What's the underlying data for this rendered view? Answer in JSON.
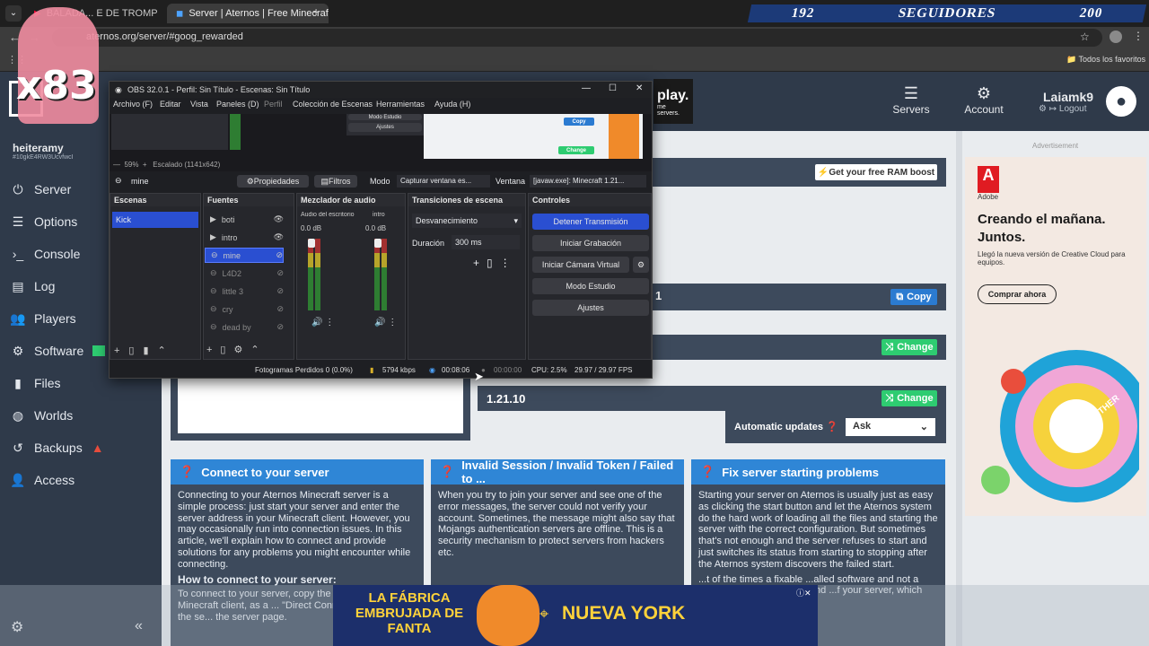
{
  "browser": {
    "tabs": [
      {
        "title": "BALADA... E DE TROMPETA..."
      },
      {
        "title": "Server | Aternos | Free Minecraft..."
      }
    ],
    "url": "aternos.org/server/#goog_rewarded",
    "bookmarks_label": "Todos los favoritos"
  },
  "overlay": {
    "counter_left": "192",
    "counter_label": "SEGUIDORES",
    "counter_right": "200",
    "multiplier": "x83"
  },
  "site": {
    "user": {
      "name": "heiteramy",
      "id": "#10gkE4RW3UcvfwcI"
    },
    "nav": [
      "Server",
      "Options",
      "Console",
      "Log",
      "Players",
      "Software",
      "Files",
      "Worlds",
      "Backups",
      "Access"
    ],
    "header": {
      "servers": "Servers",
      "account": "Account",
      "username": "Laiamk9",
      "logout": "Logout",
      "banner_text": "play.",
      "banner_sub": "me servers."
    },
    "ram_boost": "Get your free RAM boost",
    "copy": "Copy",
    "change": "Change",
    "version": "1.21.10",
    "auto_updates_label": "Automatic updates",
    "auto_updates_value": "Ask",
    "cards": [
      {
        "title": "Connect to your server",
        "body": "Connecting to your Aternos Minecraft server is a simple process: just start your server and enter the server address in your Minecraft client. However, you may occasionally run into connection issues. In this article, we'll explain how to connect and provide solutions for any problems you might encounter while connecting.",
        "subtitle": "How to connect to your server:",
        "extra": "To connect to your server, copy the s... enter it in your Minecraft client, as a ... \"Direct Connect\". You can find the se... the server page."
      },
      {
        "title": "Invalid Session / Invalid Token / Failed to ...",
        "body": "When you try to join your server and see one of the error messages, the server could not verify your account. Sometimes, the message might also say that Mojangs authentication servers are offline. This is a security mechanism to protect servers from hackers etc."
      },
      {
        "title": "Fix server starting problems",
        "body": "Starting your server on Aternos is usually just as easy as clicking the start button and let the Aternos system do the hard work of loading all the files and starting the server with the correct configuration. But sometimes that's not enough and the server refuses to start and just switches its status from starting to stopping after the Aternos system discovers the failed start.",
        "extra": "...t of the times a fixable ...alled software and not a ...em. The best source to find ...f your server, which you can"
      }
    ],
    "advertisement": "Advertisement"
  },
  "ad": {
    "brand": "Adobe",
    "headline": "Creando el mañana. Juntos.",
    "sub": "Llegó la nueva versión de Creative Cloud para equipos.",
    "cta": "Comprar ahora",
    "art_text": "TOGETHER"
  },
  "banner": {
    "left": "LA FÁBRICA EMBRUJADA DE FANTA",
    "right": "NUEVA YORK"
  },
  "obs": {
    "title": "OBS 32.0.1 - Perfil: Sin Título - Escenas: Sin Título",
    "menu": [
      "Archivo (F)",
      "Editar",
      "Vista",
      "Paneles (D)",
      "Perfil",
      "Colección de Escenas",
      "Herramientas",
      "Ayuda (H)"
    ],
    "zoom": "59%",
    "scale": "Escalado (1141x642)",
    "source_name": "mine",
    "properties": "Propiedades",
    "filters": "Filtros",
    "mode_label": "Modo",
    "mode_value": "Capturar ventana es...",
    "window_label": "Ventana",
    "window_value": "[javaw.exe]: Minecraft 1.21...",
    "docks": {
      "scenes": "Escenas",
      "sources": "Fuentes",
      "mixer": "Mezclador de audio",
      "transitions": "Transiciones de escena",
      "controls": "Controles"
    },
    "scenes": [
      "Kick"
    ],
    "sources": [
      "boti",
      "intro",
      "mine",
      "L4D2",
      "little 3",
      "cry",
      "dead by"
    ],
    "mixer": [
      {
        "name": "Audio del escritorio",
        "db": "0.0 dB"
      },
      {
        "name": "intro",
        "db": "0.0 dB"
      }
    ],
    "transition": "Desvanecimiento",
    "duration_label": "Duración",
    "duration": "300 ms",
    "controls": [
      "Detener Transmisión",
      "Iniciar Grabación",
      "Iniciar Cámara Virtual",
      "Modo Estudio",
      "Ajustes"
    ],
    "status": {
      "dropped": "Fotogramas Perdidos 0 (0.0%)",
      "bitrate": "5794 kbps",
      "stream_time": "00:08:06",
      "rec_time": "00:00:00",
      "cpu": "CPU: 2.5%",
      "fps": "29.97 / 29.97 FPS"
    },
    "preview_buttons": [
      "Modo Estudio",
      "Ajustes",
      "Copy",
      "Change"
    ]
  },
  "colors": {
    "site_bg": "#2f3a4a",
    "accent_blue": "#2f86d6",
    "accent_green": "#2ecc71",
    "obs_active": "#2a4fd1"
  }
}
